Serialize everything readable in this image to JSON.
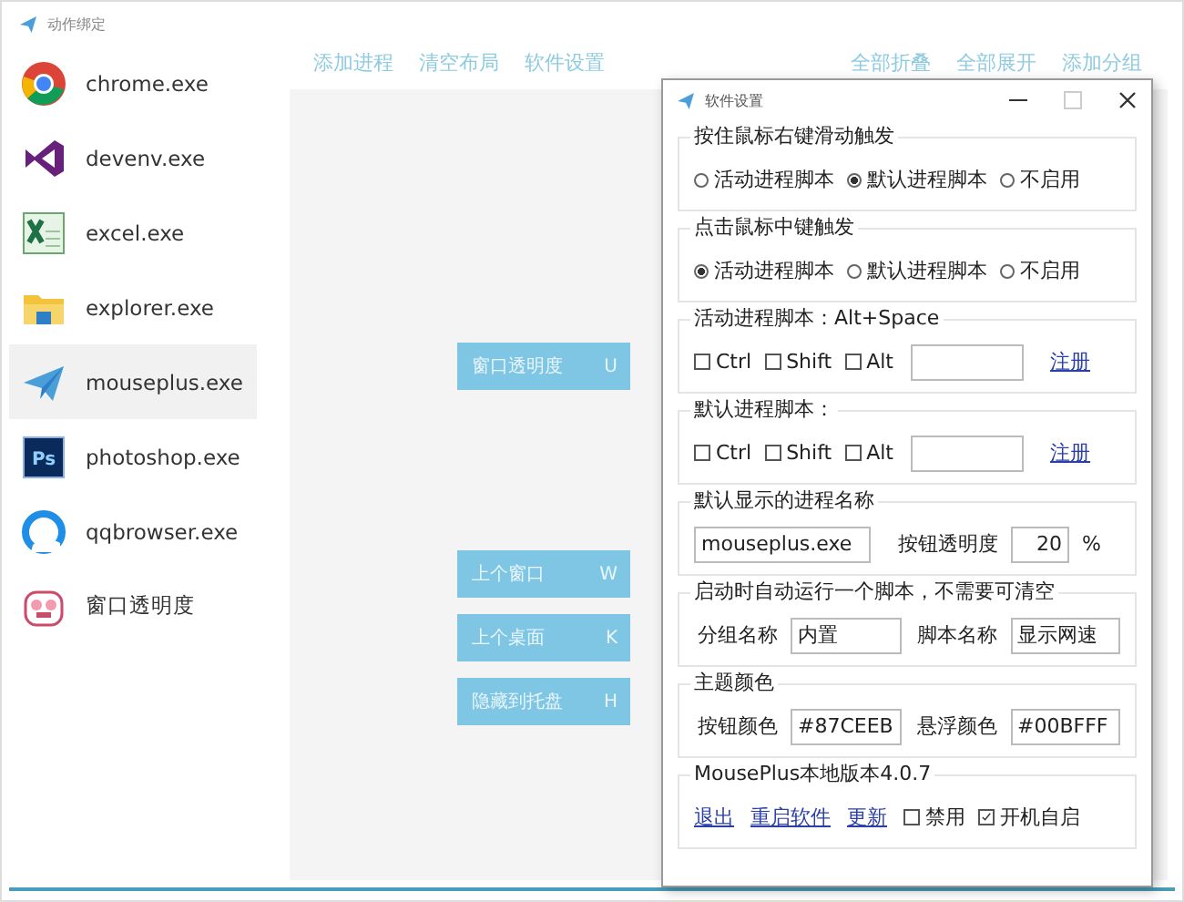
{
  "window": {
    "title": "动作绑定"
  },
  "sidebar": {
    "items": [
      {
        "label": "chrome.exe",
        "kind": "chrome",
        "selected": false
      },
      {
        "label": "devenv.exe",
        "kind": "studio",
        "selected": false
      },
      {
        "label": "excel.exe",
        "kind": "excel",
        "selected": false
      },
      {
        "label": "explorer.exe",
        "kind": "folder",
        "selected": false
      },
      {
        "label": "mouseplus.exe",
        "kind": "plane",
        "selected": true
      },
      {
        "label": "photoshop.exe",
        "kind": "ps",
        "icon_text": "Ps",
        "selected": false
      },
      {
        "label": "qqbrowser.exe",
        "kind": "ring",
        "selected": false
      },
      {
        "label": "窗口透明度",
        "kind": "face",
        "selected": false
      }
    ]
  },
  "toolbar": {
    "left_links": [
      "添加进程",
      "清空布局",
      "软件设置"
    ],
    "right_links": [
      "全部折叠",
      "全部展开",
      "添加分组"
    ]
  },
  "buttons": [
    {
      "label": "窗口透明度",
      "key": "U"
    },
    {
      "label": "上个窗口",
      "key": "W"
    },
    {
      "label": "上个桌面",
      "key": "K"
    },
    {
      "label": "隐藏到托盘",
      "key": "H"
    }
  ],
  "dialog": {
    "title": "软件设置",
    "groups": [
      {
        "kind": "radio",
        "title": "按住鼠标右键滑动触发",
        "options": [
          {
            "label": "活动进程脚本",
            "selected": false
          },
          {
            "label": "默认进程脚本",
            "selected": true
          },
          {
            "label": "不启用",
            "selected": false
          }
        ]
      },
      {
        "kind": "radio",
        "title": "点击鼠标中键触发",
        "options": [
          {
            "label": "活动进程脚本",
            "selected": true
          },
          {
            "label": "默认进程脚本",
            "selected": false
          },
          {
            "label": "不启用",
            "selected": false
          }
        ]
      },
      {
        "kind": "hotkey",
        "title": "活动进程脚本：Alt+Space",
        "modifiers": [
          {
            "label": "Ctrl",
            "checked": false
          },
          {
            "label": "Shift",
            "checked": false
          },
          {
            "label": "Alt",
            "checked": false
          }
        ],
        "link": "注册"
      },
      {
        "kind": "hotkey",
        "title": "默认进程脚本：",
        "modifiers": [
          {
            "label": "Ctrl",
            "checked": false
          },
          {
            "label": "Shift",
            "checked": false
          },
          {
            "label": "Alt",
            "checked": false
          }
        ],
        "link": "注册"
      },
      {
        "kind": "process",
        "title": "默认显示的进程名称",
        "value": "mouseplus.exe",
        "opacity_label": "按钮透明度",
        "opacity": "20",
        "unit": "%"
      },
      {
        "kind": "fields",
        "title": "启动时自动运行一个脚本，不需要可清空",
        "fields": [
          {
            "label": "分组名称",
            "value": "内置"
          },
          {
            "label": "脚本名称",
            "value": "显示网速"
          }
        ]
      },
      {
        "kind": "fields",
        "title": "主题颜色",
        "fields": [
          {
            "label": "按钮颜色",
            "value": "#87CEEB"
          },
          {
            "label": "悬浮颜色",
            "value": "#00BFFF"
          }
        ]
      },
      {
        "kind": "footer",
        "title": "MousePlus本地版本4.0.7",
        "links": [
          "退出",
          "重启软件",
          "更新"
        ],
        "checks": [
          {
            "label": "禁用",
            "checked": false
          },
          {
            "label": "开机自启",
            "checked": true
          }
        ]
      }
    ]
  }
}
